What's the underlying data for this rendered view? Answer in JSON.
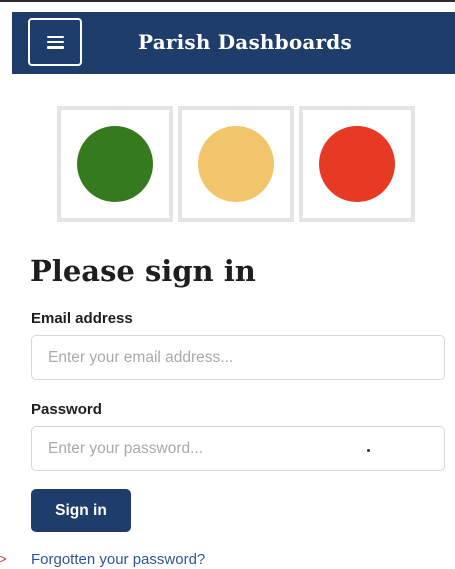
{
  "header": {
    "title": "Parish Dashboards",
    "menu_icon": "hamburger-menu-icon",
    "background_color": "#1f3d6b"
  },
  "traffic_lights": [
    {
      "name": "green",
      "color": "#357a1e"
    },
    {
      "name": "amber",
      "color": "#f3c56a"
    },
    {
      "name": "red",
      "color": "#e63a24"
    }
  ],
  "form": {
    "heading": "Please sign in",
    "email": {
      "label": "Email address",
      "placeholder": "Enter your email address...",
      "value": ""
    },
    "password": {
      "label": "Password",
      "placeholder": "Enter your password...",
      "value": ""
    },
    "submit_label": "Sign in",
    "forgot_link": "Forgotten your password?"
  },
  "colors": {
    "primary": "#1f3d6b",
    "link": "#2b5797",
    "input_border": "#d7d7d7",
    "box_border": "#e4e4e4"
  }
}
